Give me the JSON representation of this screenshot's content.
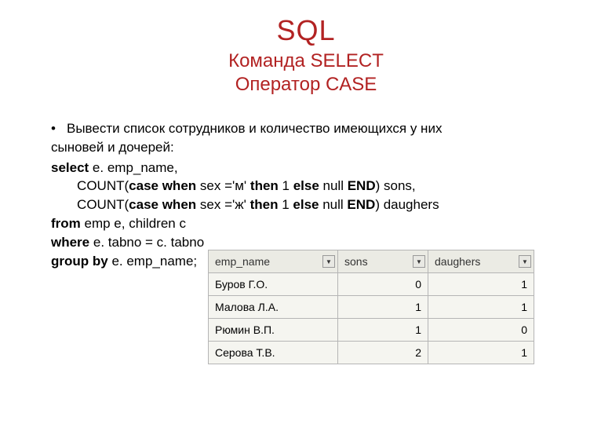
{
  "title": {
    "main": "SQL",
    "sub1": "Команда SELECT",
    "sub2": "Оператор CASE"
  },
  "task": {
    "bullet": "•",
    "line1": "Вывести список сотрудников и количество имеющихся у них",
    "line2": "сыновей и дочерей:"
  },
  "sql": {
    "kw_select": "select",
    "select_rest": " e. emp_name,",
    "count1_pre": "       COUNT(",
    "kw_case1": "case when",
    "count1_mid": " sex ='м' ",
    "kw_then1": "then",
    "count1_mid2": " 1 ",
    "kw_else1": "else",
    "count1_mid3": " null ",
    "kw_end1": "END",
    "count1_post": ") sons,",
    "count2_pre": "       COUNT(",
    "kw_case2": "case when",
    "count2_mid": " sex ='ж' ",
    "kw_then2": "then",
    "count2_mid2": " 1 ",
    "kw_else2": "else",
    "count2_mid3": " null ",
    "kw_end2": "END",
    "count2_post": ") daughers",
    "kw_from": "from",
    "from_rest": " emp e, children c",
    "kw_where": "where",
    "where_rest": " e. tabno = c. tabno",
    "kw_groupby": "group by",
    "groupby_rest": " e. emp_name;"
  },
  "table": {
    "headers": {
      "emp": "emp_name",
      "sons": "sons",
      "daughers": "daughers"
    },
    "rows": [
      {
        "emp": "Буров Г.О.",
        "sons": "0",
        "daughers": "1"
      },
      {
        "emp": "Малова Л.А.",
        "sons": "1",
        "daughers": "1"
      },
      {
        "emp": "Рюмин В.П.",
        "sons": "1",
        "daughers": "0"
      },
      {
        "emp": "Серова Т.В.",
        "sons": "2",
        "daughers": "1"
      }
    ]
  },
  "icons": {
    "dropdown": "▼"
  },
  "chart_data": {
    "type": "table",
    "title": "Employee children counts",
    "columns": [
      "emp_name",
      "sons",
      "daughers"
    ],
    "rows": [
      [
        "Буров Г.О.",
        0,
        1
      ],
      [
        "Малова Л.А.",
        1,
        1
      ],
      [
        "Рюмин В.П.",
        1,
        0
      ],
      [
        "Серова Т.В.",
        2,
        1
      ]
    ]
  }
}
